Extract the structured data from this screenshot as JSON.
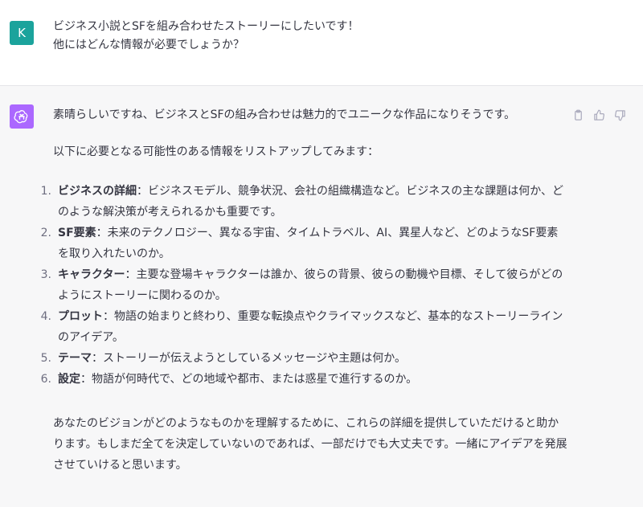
{
  "user": {
    "avatar_letter": "K",
    "avatar_color": "#1ba39c",
    "lines": [
      "ビジネス小説とSFを組み合わせたストーリーにしたいです！",
      "他にはどんな情報が必要でしょうか？"
    ]
  },
  "assistant": {
    "avatar_icon": "openai-logo-icon",
    "avatar_color": "#ab68ff",
    "intro": "素晴らしいですね、ビジネスとSFの組み合わせは魅力的でユニークな作品になりそうです。",
    "lead": "以下に必要となる可能性のある情報をリストアップしてみます：",
    "items": [
      {
        "num": "1.",
        "term": "ビジネスの詳細",
        "sep": "：",
        "text": "ビジネスモデル、競争状況、会社の組織構造など。ビジネスの主な課題は何か、どのような解決策が考えられるかも重要です。"
      },
      {
        "num": "2.",
        "term": "SF要素",
        "sep": "：",
        "text": "未来のテクノロジー、異なる宇宙、タイムトラベル、AI、異星人など、どのようなSF要素を取り入れたいのか。"
      },
      {
        "num": "3.",
        "term": "キャラクター",
        "sep": "：",
        "text": "主要な登場キャラクターは誰か、彼らの背景、彼らの動機や目標、そして彼らがどのようにストーリーに関わるのか。"
      },
      {
        "num": "4.",
        "term": "プロット",
        "sep": "：",
        "text": "物語の始まりと終わり、重要な転換点やクライマックスなど、基本的なストーリーラインのアイデア。"
      },
      {
        "num": "5.",
        "term": "テーマ",
        "sep": "：",
        "text": "ストーリーが伝えようとしているメッセージや主題は何か。"
      },
      {
        "num": "6.",
        "term": "設定",
        "sep": "：",
        "text": "物語が何時代で、どの地域や都市、または惑星で進行するのか。"
      }
    ],
    "closing": "あなたのビジョンがどのようなものかを理解するために、これらの詳細を提供していただけると助かります。もしまだ全てを決定していないのであれば、一部だけでも大丈夫です。一緒にアイデアを発展させていけると思います。"
  },
  "actions": {
    "copy_icon": "clipboard-icon",
    "like_icon": "thumbs-up-icon",
    "dislike_icon": "thumbs-down-icon"
  }
}
